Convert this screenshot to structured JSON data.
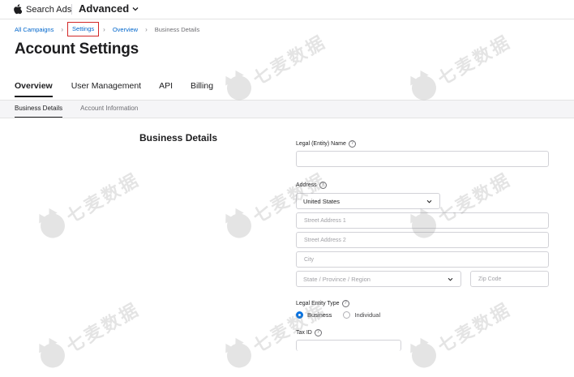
{
  "header": {
    "brand": "Search Ads",
    "mode": "Advanced"
  },
  "breadcrumb": {
    "items": [
      "All Campaigns",
      "Settings",
      "Overview",
      "Business Details"
    ]
  },
  "page": {
    "title": "Account Settings"
  },
  "tabs": [
    "Overview",
    "User Management",
    "API",
    "Billing"
  ],
  "subtabs": [
    "Business Details",
    "Account Information"
  ],
  "form": {
    "section_title": "Business Details",
    "legal_name_label": "Legal (Entity) Name",
    "legal_name_value": "",
    "address_label": "Address",
    "country_value": "United States",
    "street1_placeholder": "Street Address 1",
    "street2_placeholder": "Street Address 2",
    "city_placeholder": "City",
    "state_placeholder": "State / Province / Region",
    "zip_placeholder": "Zip Code",
    "entity_type_label": "Legal Entity Type",
    "entity_options": [
      "Business",
      "Individual"
    ],
    "entity_selected": "Business",
    "tax_id_label": "Tax ID",
    "help_glyph": "?"
  },
  "watermark": {
    "text": "七麦数据"
  },
  "colors": {
    "accent": "#0071e3",
    "link": "#0066cc",
    "highlight_box": "#d22727"
  },
  "icons": [
    "apple-icon",
    "chevron-down-icon",
    "help-icon",
    "cat-logo-icon"
  ]
}
